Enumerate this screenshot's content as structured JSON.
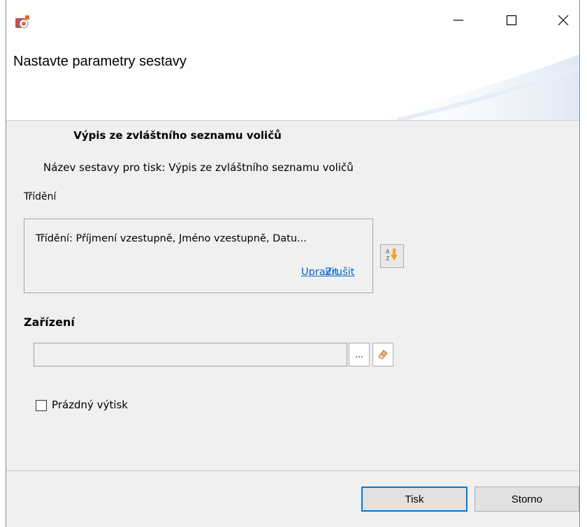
{
  "titlebar": {
    "icons": [
      "app-icon",
      "minimize-icon",
      "maximize-icon",
      "close-icon"
    ]
  },
  "header": {
    "title": "Nastavte parametry sestavy"
  },
  "main": {
    "report_name": "Výpis ze zvláštního seznamu voličů",
    "print_name": "Název sestavy pro tisk: Výpis ze zvláštního seznamu voličů",
    "sort": {
      "section_label": "Třídění",
      "text": "Třídění: Příjmení vzestupně, Jméno vzestupně, Datu...",
      "edit_link": "Upravit",
      "cancel_link": "Zrušit",
      "sort_icon": "sort-az-icon"
    },
    "device": {
      "label": "Zařízení",
      "value": "",
      "browse_label": "...",
      "clear_icon": "eraser-icon"
    },
    "empty_print": {
      "label": "Prázdný výtisk",
      "checked": false
    }
  },
  "footer": {
    "print_label": "Tisk",
    "cancel_label": "Storno"
  },
  "colors": {
    "link": "#0066cc",
    "default_button_border": "#0078d7",
    "body_bg": "#f0f0f0"
  }
}
